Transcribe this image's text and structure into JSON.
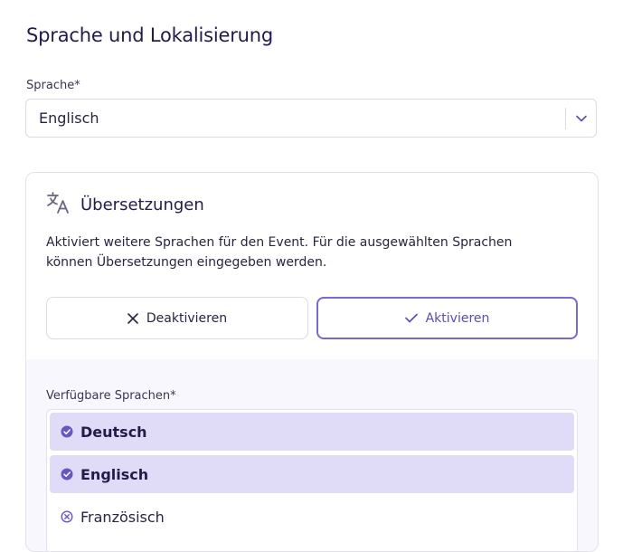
{
  "section": {
    "title": "Sprache und Lokalisierung"
  },
  "language_field": {
    "label": "Sprache*",
    "value": "Englisch"
  },
  "translations": {
    "title": "Übersetzungen",
    "icon": "translate-icon",
    "description": "Aktiviert weitere Sprachen für den Event. Für die ausgewählten Sprachen können Übersetzungen eingegeben werden.",
    "deactivate_label": "Deaktivieren",
    "activate_label": "Aktivieren",
    "active_state": "Aktivieren"
  },
  "available_languages": {
    "label": "Verfügbare Sprachen*",
    "items": [
      {
        "label": "Deutsch",
        "selected": true
      },
      {
        "label": "Englisch",
        "selected": true
      },
      {
        "label": "Französisch",
        "selected": false
      }
    ]
  },
  "colors": {
    "accent": "#7c68cc",
    "selected_bg": "#e0dcf8",
    "title": "#241b4a",
    "panel_bg": "#f8f7fd"
  }
}
